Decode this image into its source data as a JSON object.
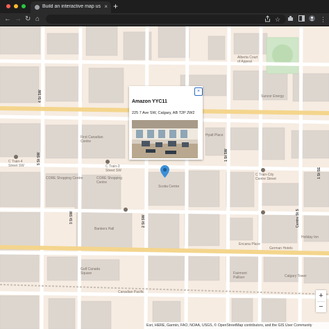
{
  "browser": {
    "tab_title": "Build an interactive map using",
    "tab_close": "×",
    "new_tab": "+",
    "back": "←",
    "forward": "→",
    "reload": "↻",
    "home": "⌂",
    "traffic_colors": [
      "#ff5f57",
      "#febc2e",
      "#28c840"
    ]
  },
  "map": {
    "landmarks": [
      {
        "name": "Alberta Court of Appeal",
        "lines": [
          "Alberta Court",
          "of Appeal"
        ]
      },
      {
        "name": "Suncor Energy",
        "lines": [
          "Suncor Energy"
        ]
      },
      {
        "name": "First Canadian Centre",
        "lines": [
          "First Canadian",
          "Centre"
        ]
      },
      {
        "name": "Hyatt Place",
        "lines": [
          "Hyatt Place"
        ]
      },
      {
        "name": "C-Train-3 Street SW",
        "lines": [
          "C Train-3",
          "Street SW"
        ]
      },
      {
        "name": "CORE Shopping Centre",
        "lines": [
          "CORE Shopping",
          "Centre"
        ]
      },
      {
        "name": "CORE Shopping Centre (west)",
        "lines": [
          "CORE Shopping Centre"
        ]
      },
      {
        "name": "C Train-4 Street SW",
        "lines": [
          "C Train-4",
          "Street SW"
        ]
      },
      {
        "name": "Scotia Centre",
        "lines": [
          "Scotia Centre"
        ]
      },
      {
        "name": "C Train-City Centre Street",
        "lines": [
          "C Train-City",
          "Centre Street"
        ]
      },
      {
        "name": "Bankers Hall",
        "lines": [
          "Bankers Hall"
        ]
      },
      {
        "name": "Encana Place",
        "lines": [
          "Encana Place"
        ]
      },
      {
        "name": "German Hotels",
        "lines": [
          "German Hotels"
        ]
      },
      {
        "name": "Holiday Inn",
        "lines": [
          "Holiday Inn"
        ]
      },
      {
        "name": "Gulf Canada Square",
        "lines": [
          "Gulf Canada",
          "Square"
        ]
      },
      {
        "name": "Fairmont Palliser",
        "lines": [
          "Fairmont",
          "Palliser"
        ]
      },
      {
        "name": "Calgary Tower",
        "lines": [
          "Calgary Tower"
        ]
      },
      {
        "name": "Canadian Pacific",
        "lines": [
          "Canadian Pacific"
        ]
      }
    ],
    "streets": [
      {
        "name": "4 St SW"
      },
      {
        "name": "5 St SW"
      },
      {
        "name": "3 St SW"
      },
      {
        "name": "2 St SW"
      },
      {
        "name": "1 St SW"
      },
      {
        "name": "Centre St S"
      },
      {
        "name": "1 St SE"
      }
    ]
  },
  "popup": {
    "title": "Amazon YYC11",
    "address": "225 7 Ave SW, Calgary, AB T2P 2W2",
    "close_label": "×"
  },
  "zoom": {
    "in_label": "+",
    "out_label": "−"
  },
  "attribution": "Esri, HERE, Garmin, FAO, NOAA, USGS, © OpenStreetMap contributors, and the GIS User Community"
}
